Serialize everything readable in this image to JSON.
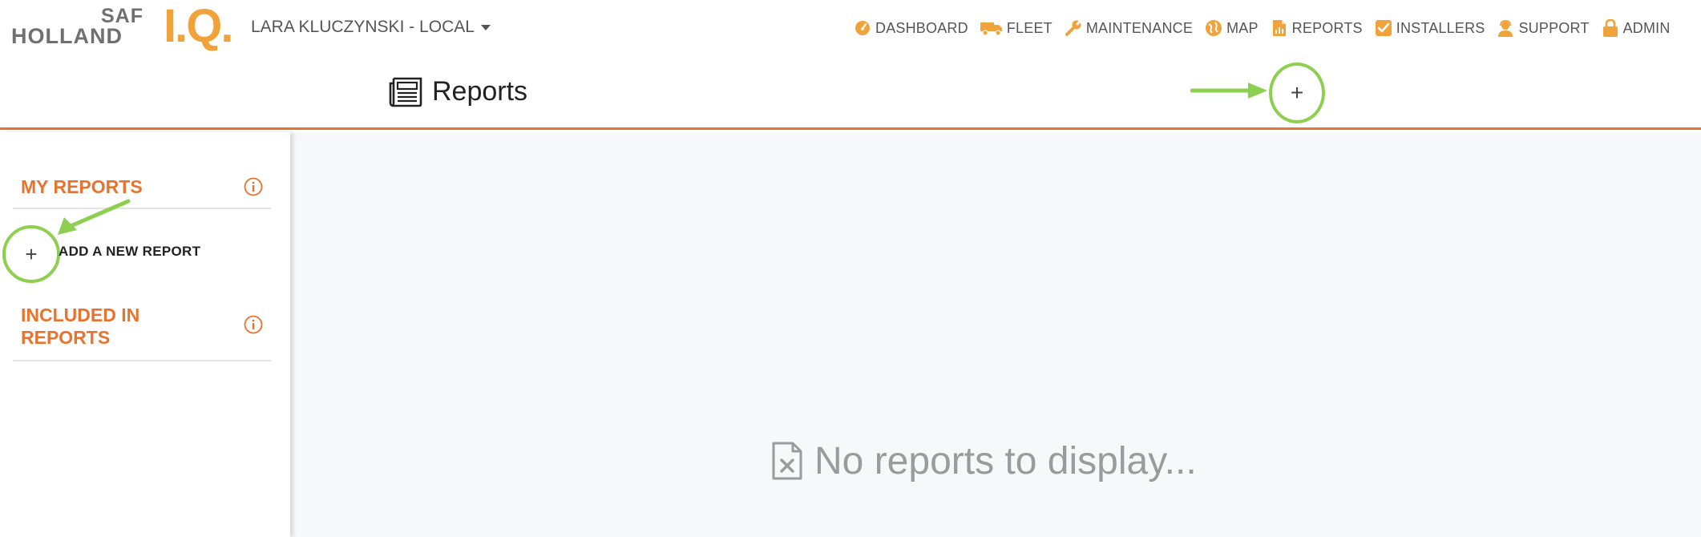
{
  "brand": {
    "logo_top": "SAF",
    "logo_bottom": "HOLLAND",
    "logo_mark": "I.Q.",
    "accent_color": "#e8732e",
    "logo_color": "#f0a33a",
    "annotation_color": "#8dcf4f"
  },
  "user_menu": {
    "name": "LARA KLUCZYNSKI - LOCAL",
    "icon": "caret-down-icon"
  },
  "nav": [
    {
      "label": "DASHBOARD",
      "icon": "dashboard-gauge-icon"
    },
    {
      "label": "FLEET",
      "icon": "truck-icon"
    },
    {
      "label": "MAINTENANCE",
      "icon": "wrench-icon"
    },
    {
      "label": "MAP",
      "icon": "globe-icon"
    },
    {
      "label": "REPORTS",
      "icon": "report-file-icon"
    },
    {
      "label": "INSTALLERS",
      "icon": "checkbox-icon"
    },
    {
      "label": "SUPPORT",
      "icon": "support-agent-icon"
    },
    {
      "label": "ADMIN",
      "icon": "lock-icon"
    }
  ],
  "page": {
    "title": "Reports",
    "title_icon": "newspaper-icon",
    "add_icon": "plus-icon",
    "add_glyph": "+"
  },
  "sidebar": {
    "my_reports_title": "MY REPORTS",
    "add_glyph": "+",
    "add_new_report_label": "ADD A NEW REPORT",
    "included_in_reports_title_line1": "INCLUDED IN",
    "included_in_reports_title_line2": "REPORTS",
    "info_icon": "info-circle-icon"
  },
  "main": {
    "empty_message": "No reports to display...",
    "empty_icon": "file-x-icon"
  }
}
